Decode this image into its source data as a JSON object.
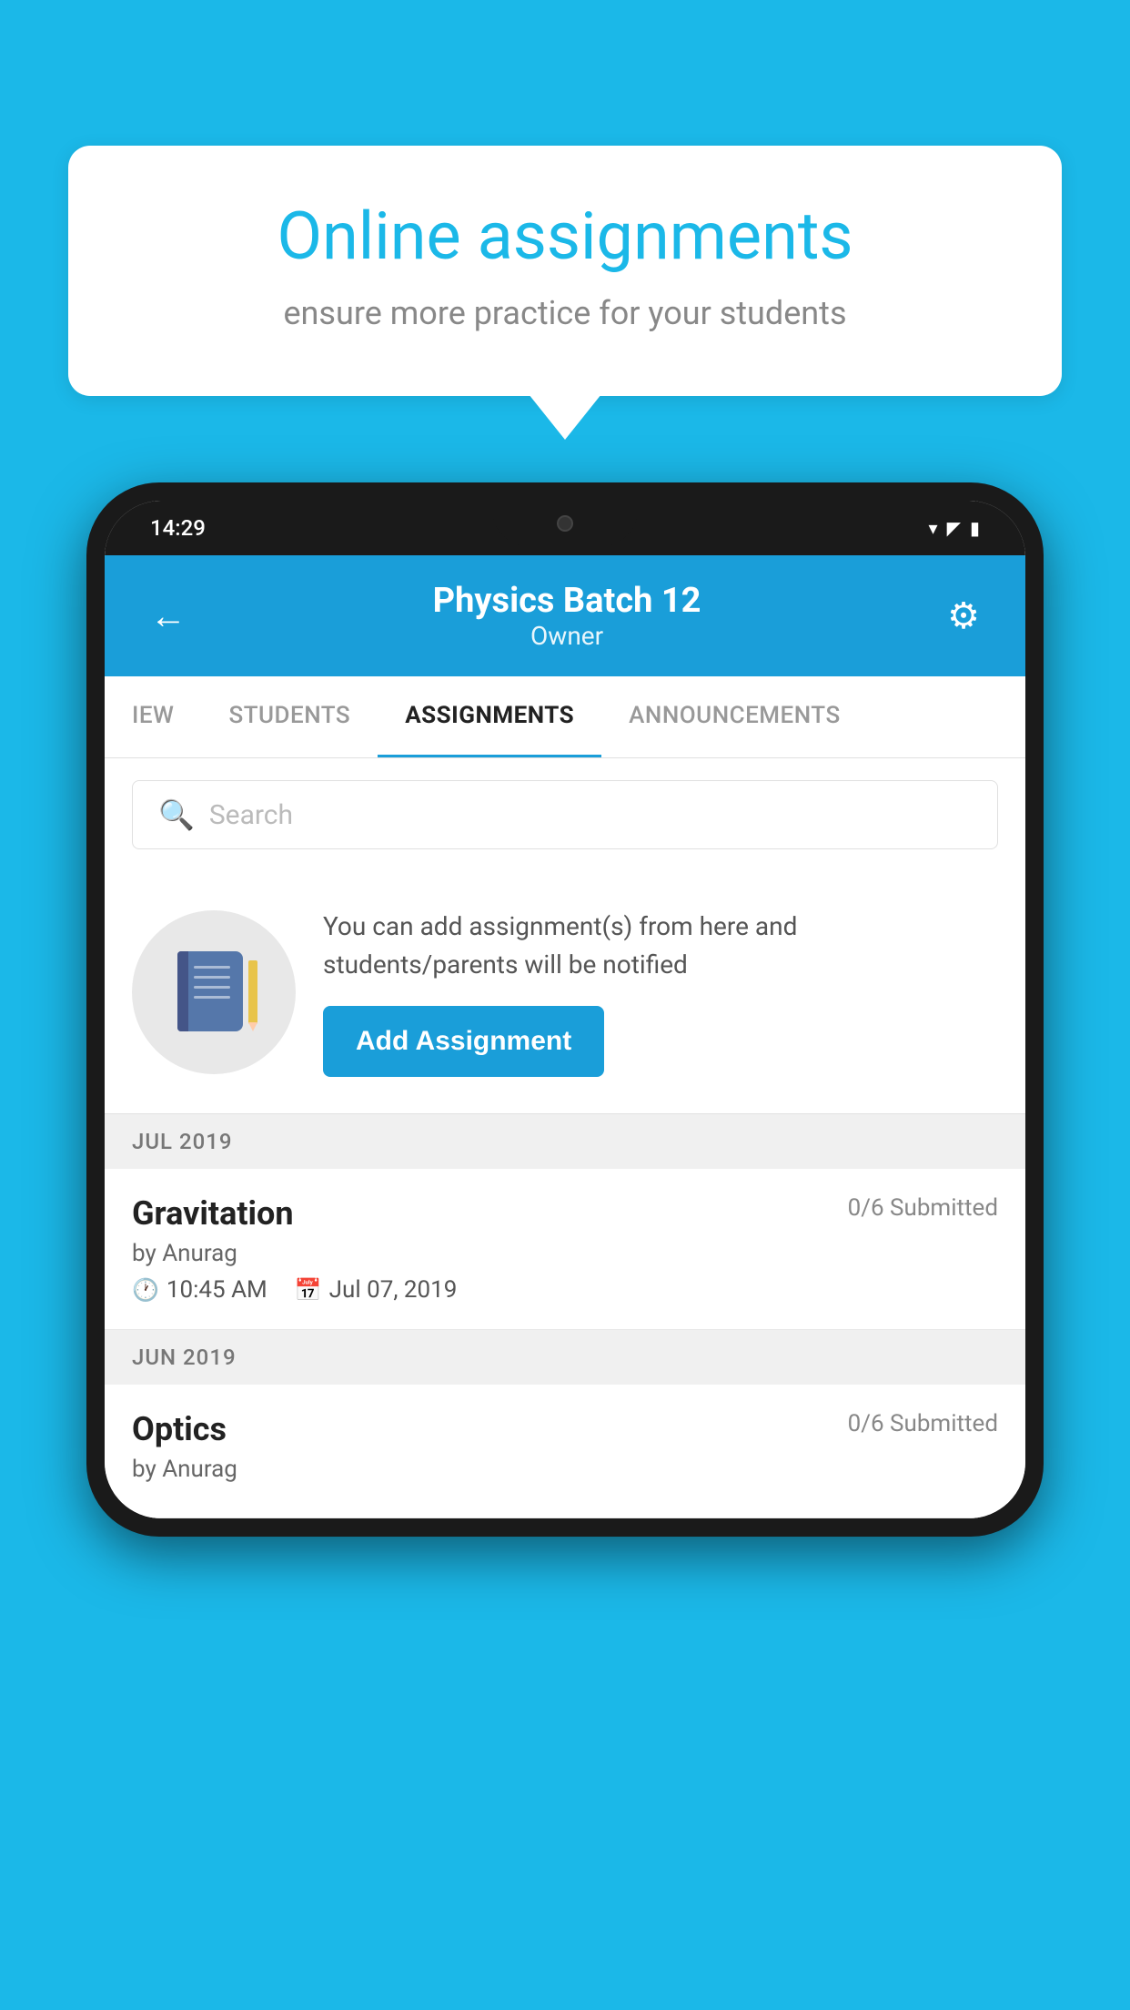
{
  "background_color": "#1BB8E8",
  "speech_bubble": {
    "title": "Online assignments",
    "subtitle": "ensure more practice for your students"
  },
  "phone": {
    "status_bar": {
      "time": "14:29",
      "icons": [
        "wifi",
        "signal",
        "battery"
      ]
    },
    "header": {
      "back_label": "←",
      "title": "Physics Batch 12",
      "subtitle": "Owner",
      "gear_label": "⚙"
    },
    "tabs": [
      {
        "label": "IEW",
        "active": false
      },
      {
        "label": "STUDENTS",
        "active": false
      },
      {
        "label": "ASSIGNMENTS",
        "active": true
      },
      {
        "label": "ANNOUNCEMENTS",
        "active": false
      }
    ],
    "search": {
      "placeholder": "Search"
    },
    "promo": {
      "description": "You can add assignment(s) from here and students/parents will be notified",
      "button_label": "Add Assignment"
    },
    "sections": [
      {
        "month_label": "JUL 2019",
        "assignments": [
          {
            "title": "Gravitation",
            "submitted": "0/6 Submitted",
            "author": "by Anurag",
            "time": "10:45 AM",
            "date": "Jul 07, 2019"
          }
        ]
      },
      {
        "month_label": "JUN 2019",
        "assignments": [
          {
            "title": "Optics",
            "submitted": "0/6 Submitted",
            "author": "by Anurag",
            "time": "",
            "date": ""
          }
        ]
      }
    ]
  }
}
